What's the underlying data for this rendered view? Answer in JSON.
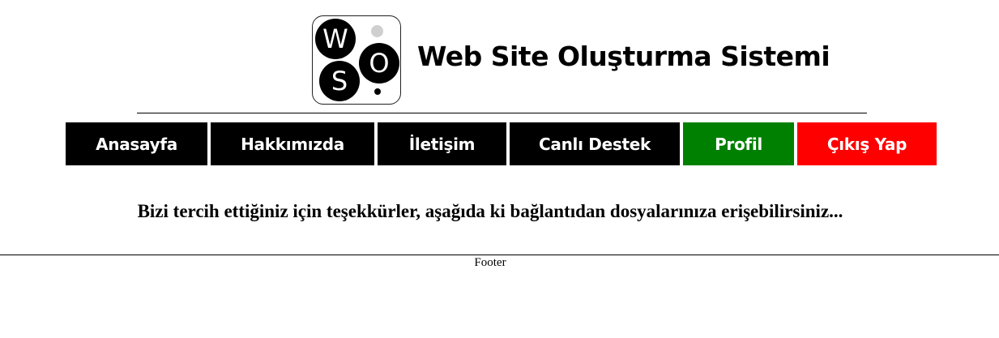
{
  "header": {
    "logo": {
      "letters": [
        "W",
        "O",
        "S"
      ]
    },
    "title": "Web Site Oluşturma Sistemi"
  },
  "nav": {
    "items": [
      {
        "label": "Anasayfa",
        "color": "#000000"
      },
      {
        "label": "Hakkımızda",
        "color": "#000000"
      },
      {
        "label": "İletişim",
        "color": "#000000"
      },
      {
        "label": "Canlı Destek",
        "color": "#000000"
      },
      {
        "label": "Profil",
        "color": "#008000"
      },
      {
        "label": "Çıkış Yap",
        "color": "#ff0000"
      }
    ]
  },
  "main": {
    "message": "Bizi tercih ettiğiniz için teşekkürler, aşağıda ki bağlantıdan dosyalarınıza erişebilirsiniz..."
  },
  "footer": {
    "text": "Footer"
  }
}
